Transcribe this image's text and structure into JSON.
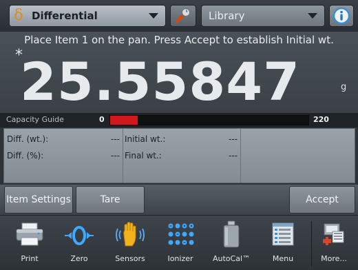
{
  "header": {
    "app_select": {
      "icon": "delta-icon",
      "value": "Differential"
    },
    "settings_icon": "wrench-icon",
    "library_select": {
      "value": "Library"
    },
    "info_icon": "info-icon"
  },
  "display": {
    "instruction": "Place Item 1 on the pan.  Press Accept to establish Initial wt.",
    "stability_mark": "*",
    "weight": "25.55847",
    "unit": "g"
  },
  "capacity": {
    "label": "Capacity Guide",
    "min": "0",
    "max": "220",
    "fill_fraction": 0.14,
    "fill_color": "#d0191e"
  },
  "results": {
    "diff_wt_label": "Diff. (wt.):",
    "diff_wt_value": "---",
    "diff_pct_label": "Diff. (%):",
    "diff_pct_value": "---",
    "initial_wt_label": "Initial wt.:",
    "initial_wt_value": "---",
    "final_wt_label": "Final wt.:",
    "final_wt_value": "---"
  },
  "softkeys": {
    "item_settings": "Item Settings",
    "tare": "Tare",
    "accept": "Accept"
  },
  "toolbar": {
    "print": "Print",
    "zero": "Zero",
    "sensors": "Sensors",
    "ionizer": "Ionizer",
    "autocal": "AutoCal™",
    "menu": "Menu",
    "more": "More..."
  }
}
